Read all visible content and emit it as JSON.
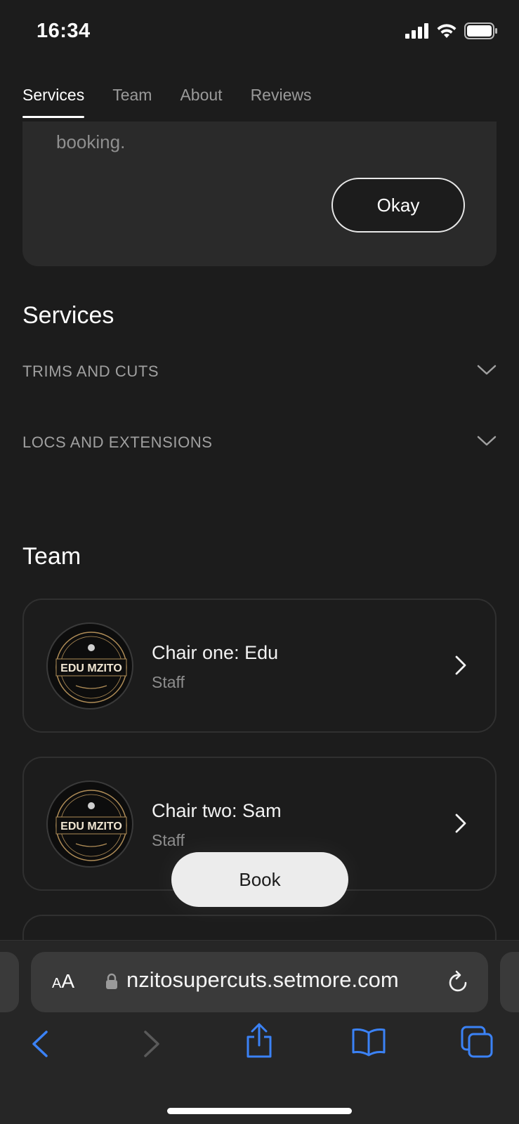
{
  "status": {
    "time": "16:34"
  },
  "tabs": [
    {
      "label": "Services",
      "active": true
    },
    {
      "label": "Team",
      "active": false
    },
    {
      "label": "About",
      "active": false
    },
    {
      "label": "Reviews",
      "active": false
    }
  ],
  "notice": {
    "text": "booking.",
    "button_label": "Okay"
  },
  "services": {
    "title": "Services",
    "categories": [
      {
        "label": "TRIMS AND CUTS"
      },
      {
        "label": "LOCS AND EXTENSIONS"
      }
    ]
  },
  "team": {
    "title": "Team",
    "members": [
      {
        "name": "Chair one: Edu",
        "role": "Staff",
        "logo_text": "EDU MZITO"
      },
      {
        "name": "Chair two: Sam",
        "role": "Staff",
        "logo_text": "EDU MZITO"
      }
    ]
  },
  "book_button": "Book",
  "browser": {
    "aa_label_small": "A",
    "aa_label_large": "A",
    "url": "nzitosupercuts.setmore.com",
    "accent_color": "#3b82f6"
  }
}
